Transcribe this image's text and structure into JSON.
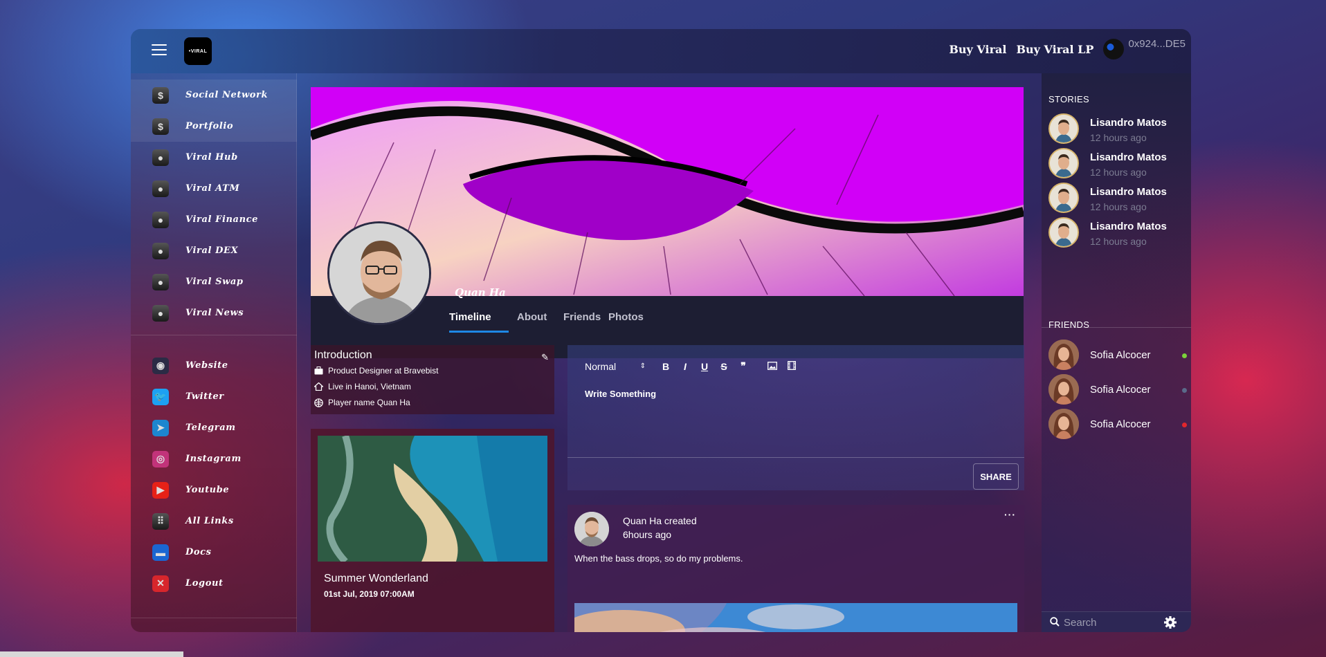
{
  "header": {
    "logo_text": "•VIRAL",
    "links": [
      "Buy Viral",
      "Buy Viral LP"
    ],
    "wallet_address": "0x924...DE5"
  },
  "sidebar": {
    "primary": [
      {
        "label": "Social Network",
        "icon": "dollar-icon",
        "active": true
      },
      {
        "label": "Portfolio",
        "icon": "dollar-icon",
        "active": true
      },
      {
        "label": "Viral Hub",
        "icon": "user-icon"
      },
      {
        "label": "Viral ATM",
        "icon": "user-icon"
      },
      {
        "label": "Viral Finance",
        "icon": "user-icon"
      },
      {
        "label": "Viral DEX",
        "icon": "user-icon"
      },
      {
        "label": "Viral Swap",
        "icon": "user-icon"
      },
      {
        "label": "Viral News",
        "icon": "user-icon"
      }
    ],
    "secondary": [
      {
        "label": "Website",
        "icon": "globe-icon"
      },
      {
        "label": "Twitter",
        "icon": "twitter-icon"
      },
      {
        "label": "Telegram",
        "icon": "telegram-icon"
      },
      {
        "label": "Instagram",
        "icon": "instagram-icon"
      },
      {
        "label": "Youtube",
        "icon": "youtube-icon"
      },
      {
        "label": "All Links",
        "icon": "grid-icon"
      },
      {
        "label": "Docs",
        "icon": "folder-icon"
      },
      {
        "label": "Logout",
        "icon": "logout-icon"
      }
    ]
  },
  "profile": {
    "name": "Quan Ha",
    "tabs": [
      "Timeline",
      "About",
      "Friends",
      "Photos"
    ],
    "active_tab": "Timeline"
  },
  "intro": {
    "title": "Introduction",
    "rows": [
      {
        "icon": "briefcase-icon",
        "text": "Product Designer at Bravebist"
      },
      {
        "icon": "home-icon",
        "text": "Live in Hanoi, Vietnam"
      },
      {
        "icon": "globe-icon",
        "text": "Player name Quan Ha"
      }
    ]
  },
  "photo_card": {
    "title": "Summer Wonderland",
    "date": "01st Jul, 2019 07:00AM"
  },
  "editor": {
    "format_select": "Normal",
    "tools": [
      "B",
      "I",
      "U",
      "S",
      "quote",
      "image",
      "video"
    ],
    "placeholder_text": "Write Something",
    "share_label": "SHARE"
  },
  "post": {
    "author_line": "Quan Ha created",
    "time": "6hours ago",
    "text": "When the bass drops, so do my problems.",
    "more": "···"
  },
  "stories": {
    "title": "STORIES",
    "items": [
      {
        "name": "Lisandro Matos",
        "time": "12 hours ago"
      },
      {
        "name": "Lisandro Matos",
        "time": "12 hours ago"
      },
      {
        "name": "Lisandro Matos",
        "time": "12 hours ago"
      },
      {
        "name": "Lisandro Matos",
        "time": "12 hours ago"
      }
    ]
  },
  "friends": {
    "title": "FRIENDS",
    "items": [
      {
        "name": "Sofia Alcocer",
        "status_color": "#7bd23a"
      },
      {
        "name": "Sofia Alcocer",
        "status_color": "#5a6a8a"
      },
      {
        "name": "Sofia Alcocer",
        "status_color": "#e2262c"
      }
    ]
  },
  "search": {
    "placeholder": "Search"
  },
  "colors": {
    "accent": "#1e88e5",
    "story_ring": "#d6b36a"
  }
}
